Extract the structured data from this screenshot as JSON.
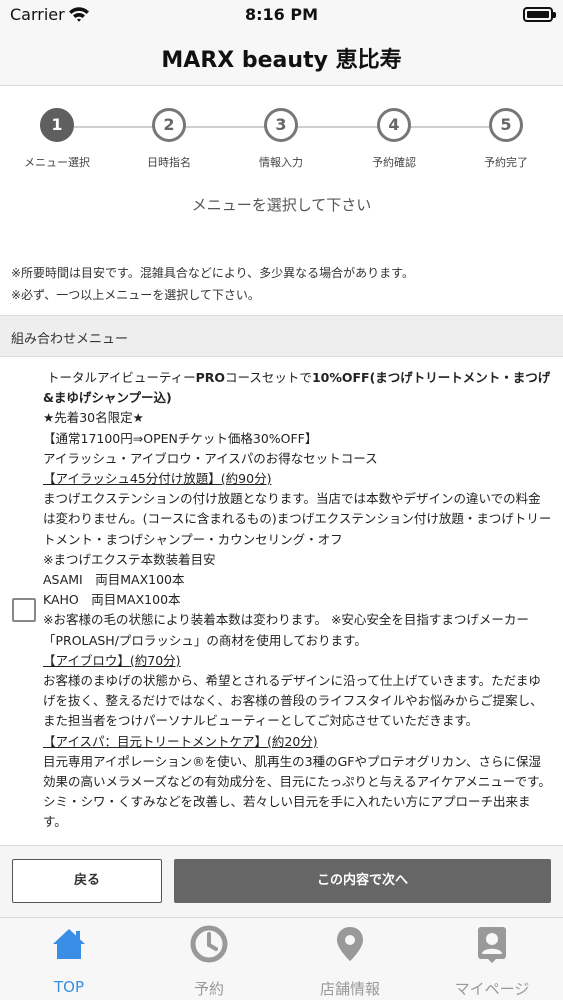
{
  "status_bar": {
    "carrier": "Carrier",
    "time": "8:16 PM"
  },
  "nav": {
    "title": "MARX beauty 恵比寿"
  },
  "steps": [
    {
      "number": "1",
      "label": "メニュー選択"
    },
    {
      "number": "2",
      "label": "日時指名"
    },
    {
      "number": "3",
      "label": "情報入力"
    },
    {
      "number": "4",
      "label": "予約確認"
    },
    {
      "number": "5",
      "label": "予約完了"
    }
  ],
  "menu_heading": "メニューを選択して下さい",
  "notes": [
    "※所要時間は目安です。混雑具合などにより、多少異なる場合があります。",
    "※必ず、一つ以上メニューを選択して下さい。"
  ],
  "section_title": "組み合わせメニュー",
  "menu_item": {
    "line1_pre": "トータルアイビューティー",
    "line1_bold1": "PRO",
    "line1_mid": "コースセットで",
    "line1_bold2": "10%OFF",
    "line1_bold3": "(まつげトリートメント・まつげ&まゆげシャンプー込)",
    "limited": "★先着30名限定★",
    "price": "【通常17100円⇒OPENチケット価格30%OFF】",
    "desc": "アイラッシュ・アイブロウ・アイスパのお得なセットコース",
    "eyelash_title": "【アイラッシュ45分付け放題】",
    "eyelash_time": "(約90分)",
    "eyelash_desc": "まつげエクステンションの付け放題となります。当店では本数やデザインの違いでの料金は変わりません。(コースに含まれるもの)まつげエクステンション付け放題・まつげトリートメント・まつげシャンプー・カウンセリング・オフ",
    "eyelash_note": "※まつげエクステ本数装着目安",
    "staff1": "ASAMI　両目MAX100本",
    "staff2": "KAHO　両目MAX100本",
    "eyelash_caution": "※お客様の毛の状態により装着本数は変わります。 ※安心安全を目指すまつげメーカー「PROLASH/プロラッシュ」の商材を使用しております。",
    "eyebrow_title": "【アイブロウ】",
    "eyebrow_time": "(約70分)",
    "eyebrow_desc": "お客様のまゆげの状態から、希望とされるデザインに沿って仕上げていきます。ただまゆげを抜く、整えるだけではなく、お客様の普段のライフスタイルやお悩みからご提案し、また担当者をつけパーソナルビューティーとしてご対応させていただきます。",
    "eyespa_title": "【アイスパ：目元トリートメントケア】",
    "eyespa_time": "(約20分)",
    "eyespa_desc": "目元専用アイポレーション®を使い、肌再生の3種のGFやプロテオグリカン、さらに保湿効果の高いメラメーズなどの有効成分を、目元にたっぷりと与えるアイケアメニューです。シミ・シワ・くすみなどを改善し、若々しい目元を手に入れたい方にアプローチ出来ます。"
  },
  "buttons": {
    "back": "戻る",
    "next": "この内容で次へ"
  },
  "tabs": [
    {
      "label": "TOP",
      "icon": "home-icon"
    },
    {
      "label": "予約",
      "icon": "clock-icon"
    },
    {
      "label": "店舗情報",
      "icon": "location-pin-icon"
    },
    {
      "label": "マイページ",
      "icon": "user-badge-icon"
    }
  ],
  "colors": {
    "accent": "#3a8ee6",
    "inactive_tab": "#999999",
    "next_button": "#666666"
  }
}
